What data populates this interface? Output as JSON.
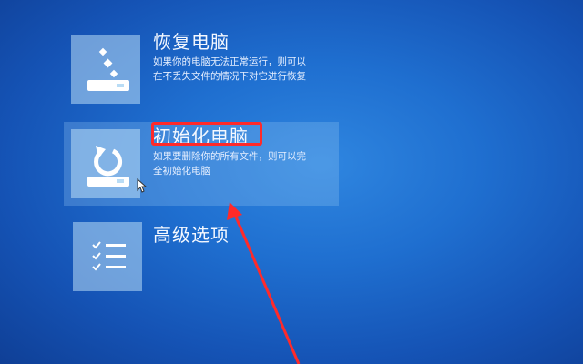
{
  "options": [
    {
      "title": "恢复电脑",
      "desc_line1": "如果你的电脑无法正常运行，则可以",
      "desc_line2": "在不丢失文件的情况下对它进行恢复",
      "icon": "refresh-pc-icon"
    },
    {
      "title": "初始化电脑",
      "desc_line1": "如果要删除你的所有文件，则可以完",
      "desc_line2": "全初始化电脑",
      "icon": "reset-pc-icon"
    },
    {
      "title": "高级选项",
      "icon": "checklist-icon"
    }
  ],
  "colors": {
    "background": "#1f6fd0",
    "tile": "#b9dcf5",
    "highlight_box": "#ff2a2a",
    "arrow": "#ff2a2a"
  }
}
